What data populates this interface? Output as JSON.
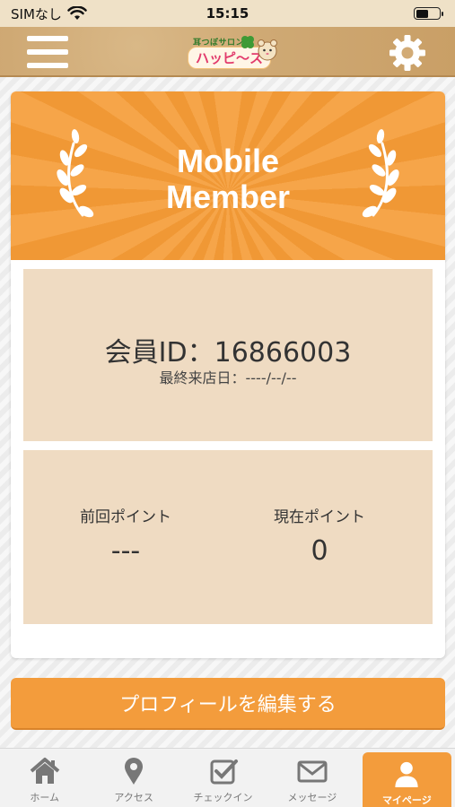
{
  "status_bar": {
    "carrier": "SIMなし",
    "time": "15:15"
  },
  "header": {
    "logo_subtitle": "耳つぼサロン",
    "logo_name": "ハッピ〜ス"
  },
  "card": {
    "banner_line1": "Mobile",
    "banner_line2": "Member",
    "member_id_label": "会員ID：",
    "member_id_value": "16866003",
    "last_visit": "最終来店日：----/--/--",
    "previous_points_label": "前回ポイント",
    "previous_points_value": "---",
    "current_points_label": "現在ポイント",
    "current_points_value": "0"
  },
  "edit_profile_label": "プロフィールを編集する",
  "tabs": [
    {
      "label": "ホーム",
      "icon": "home-icon"
    },
    {
      "label": "アクセス",
      "icon": "location-pin-icon"
    },
    {
      "label": "チェックイン",
      "icon": "checkbox-icon"
    },
    {
      "label": "メッセージ",
      "icon": "envelope-icon"
    },
    {
      "label": "マイページ",
      "icon": "user-icon"
    }
  ],
  "colors": {
    "accent": "#f39c3c",
    "panel": "#efdbc2",
    "header": "#d2ab76"
  }
}
